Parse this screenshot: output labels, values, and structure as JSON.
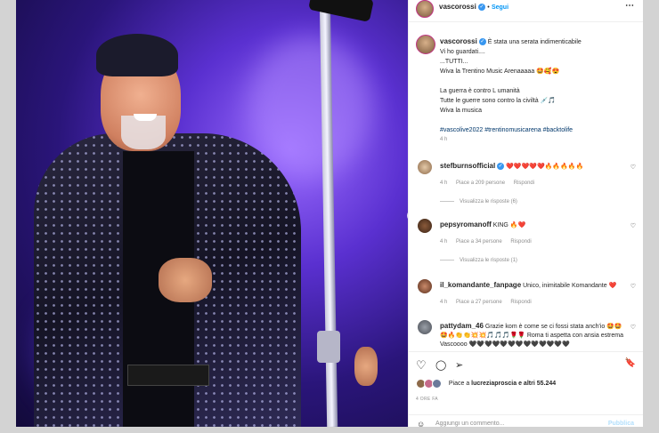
{
  "header": {
    "username": "vascorossi",
    "separator": "•",
    "follow_label": "Segui",
    "more_icon": "⋯"
  },
  "caption": {
    "username": "vascorossi",
    "lines": [
      "È stata una serata indimenticabile",
      "Vi ho guardati....",
      "...TUTTI...",
      "Wiva la Trentino Music Arenaaaaa 🤩🥰😍",
      "",
      "La guerra è contro L umanità",
      "Tutte le guerre sono contro la civiltà 💉🎵",
      "Wiva la musica",
      ""
    ],
    "hashtags": "#vascolive2022 #trentinomusicarena #backtolife",
    "time": "4 h"
  },
  "comments": [
    {
      "username": "stefburnsofficial",
      "verified": true,
      "text": "❤️❤️❤️❤️❤️🔥🔥🔥🔥🔥",
      "time": "4 h",
      "likes": "Piace a 209 persone",
      "reply": "Rispondi",
      "view_replies": "Visualizza le risposte (6)"
    },
    {
      "username": "pepsyromanoff",
      "verified": false,
      "text": "KING 🔥❤️",
      "time": "4 h",
      "likes": "Piace a 34 persone",
      "reply": "Rispondi",
      "view_replies": "Visualizza le risposte (1)"
    },
    {
      "username": "il_komandante_fanpage",
      "verified": false,
      "text": "Unico, inimitabile Komandante ❤️",
      "time": "4 h",
      "likes": "Piace a 27 persone",
      "reply": "Rispondi",
      "view_replies": ""
    },
    {
      "username": "pattydam_46",
      "verified": false,
      "text": "Grazie kom è come se ci fossi stata anch'io 🤩🤩🤩🔥👏👏💥💥🎵🎵🎵🌹🌹 Roma ti aspetta con ansia estrema Vascoooo 🖤🖤🖤🖤🖤🖤🖤🖤🖤🖤🖤🖤🖤",
      "time": "",
      "likes": "",
      "reply": "",
      "view_replies": ""
    }
  ],
  "actions": {
    "like_icon": "♡",
    "comment_icon": "◯",
    "share_icon": "➢",
    "save_icon": "🔖"
  },
  "likes_line": {
    "prefix": "Piace a",
    "user": "lucreziaprosciа",
    "suffix": "e altri 55.244"
  },
  "post_time": "4 ORE FA",
  "comment_input": {
    "placeholder": "Aggiungi un commento...",
    "publish_label": "Pubblica"
  },
  "photo": {
    "next_icon": "›"
  },
  "colors": {
    "accent": "#0095f6",
    "verified": "#3897f0",
    "stage_purple": "#5a30d0"
  }
}
